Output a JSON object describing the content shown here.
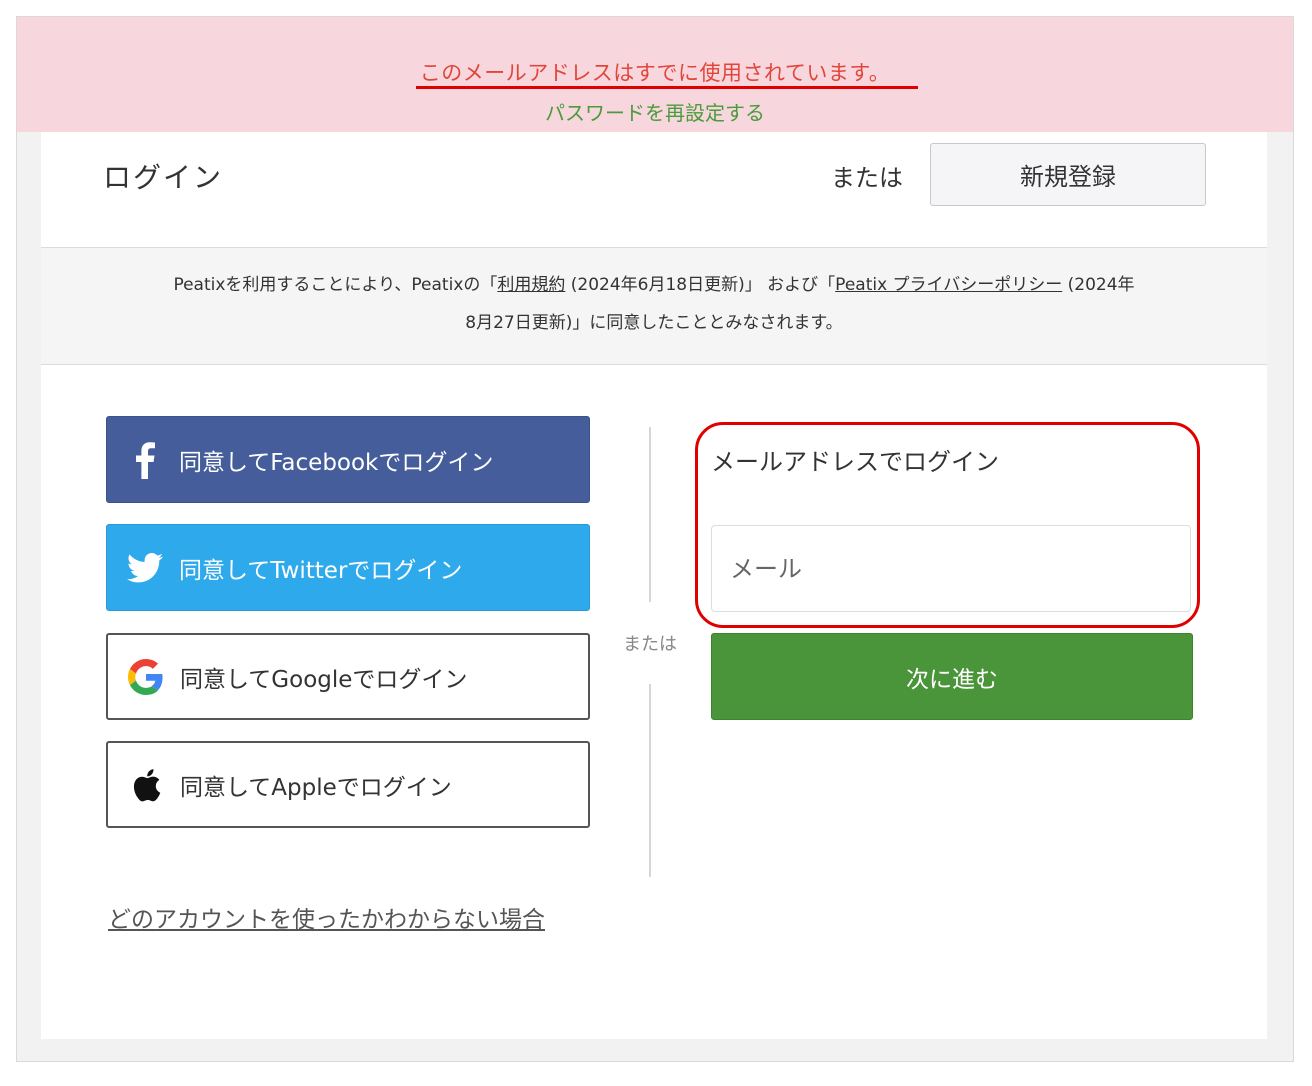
{
  "alert": {
    "message": "このメールアドレスはすでに使用されています。",
    "reset_link": "パスワードを再設定する",
    "message_color": "#e2463a",
    "link_color": "#4a9b3c"
  },
  "header": {
    "title": "ログイン",
    "or_label": "または",
    "signup_label": "新規登録"
  },
  "terms": {
    "part1": "Peatixを利用することにより、Peatixの「",
    "terms_link": "利用規約",
    "part2": " (2024年6月18日更新)」 および「",
    "privacy_link": "Peatix プライバシーポリシー",
    "part3": " (2024年",
    "line2": "8月27日更新)」に同意したこととみなされます。"
  },
  "social": {
    "facebook": {
      "label": "同意してFacebookでログイン",
      "icon": "facebook-icon",
      "color": "#455d9a"
    },
    "twitter": {
      "label": "同意してTwitterでログイン",
      "icon": "twitter-icon",
      "color": "#2eaaec"
    },
    "google": {
      "label": "同意してGoogleでログイン",
      "icon": "google-icon"
    },
    "apple": {
      "label": "同意してAppleでログイン",
      "icon": "apple-icon"
    }
  },
  "divider_label": "または",
  "unknown_account_link": "どのアカウントを使ったかわからない場合",
  "email_login": {
    "title": "メールアドレスでログイン",
    "placeholder": "メール",
    "value": "",
    "next_label": "次に進む",
    "next_color": "#4a943a"
  }
}
